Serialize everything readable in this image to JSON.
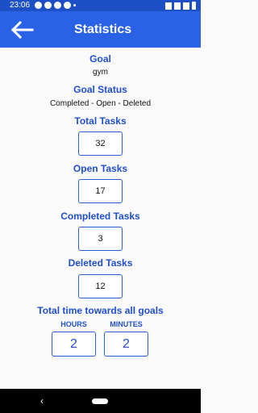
{
  "status_bar": {
    "time": "23:06"
  },
  "app_bar": {
    "title": "Statistics"
  },
  "goal": {
    "label": "Goal",
    "value": "gym"
  },
  "goal_status": {
    "label": "Goal Status",
    "value": "Completed - Open - Deleted"
  },
  "total_tasks": {
    "label": "Total Tasks",
    "value": "32"
  },
  "open_tasks": {
    "label": "Open Tasks",
    "value": "17"
  },
  "completed_tasks": {
    "label": "Completed Tasks",
    "value": "3"
  },
  "deleted_tasks": {
    "label": "Deleted Tasks",
    "value": "12"
  },
  "total_time": {
    "label": "Total time towards all goals",
    "hours_label": "HOURS",
    "hours_value": "2",
    "minutes_label": "MINUTES",
    "minutes_value": "2"
  },
  "colors": {
    "primary": "#2a62e6",
    "status_bar": "#1d4fc7",
    "label": "#1f4fcf"
  }
}
